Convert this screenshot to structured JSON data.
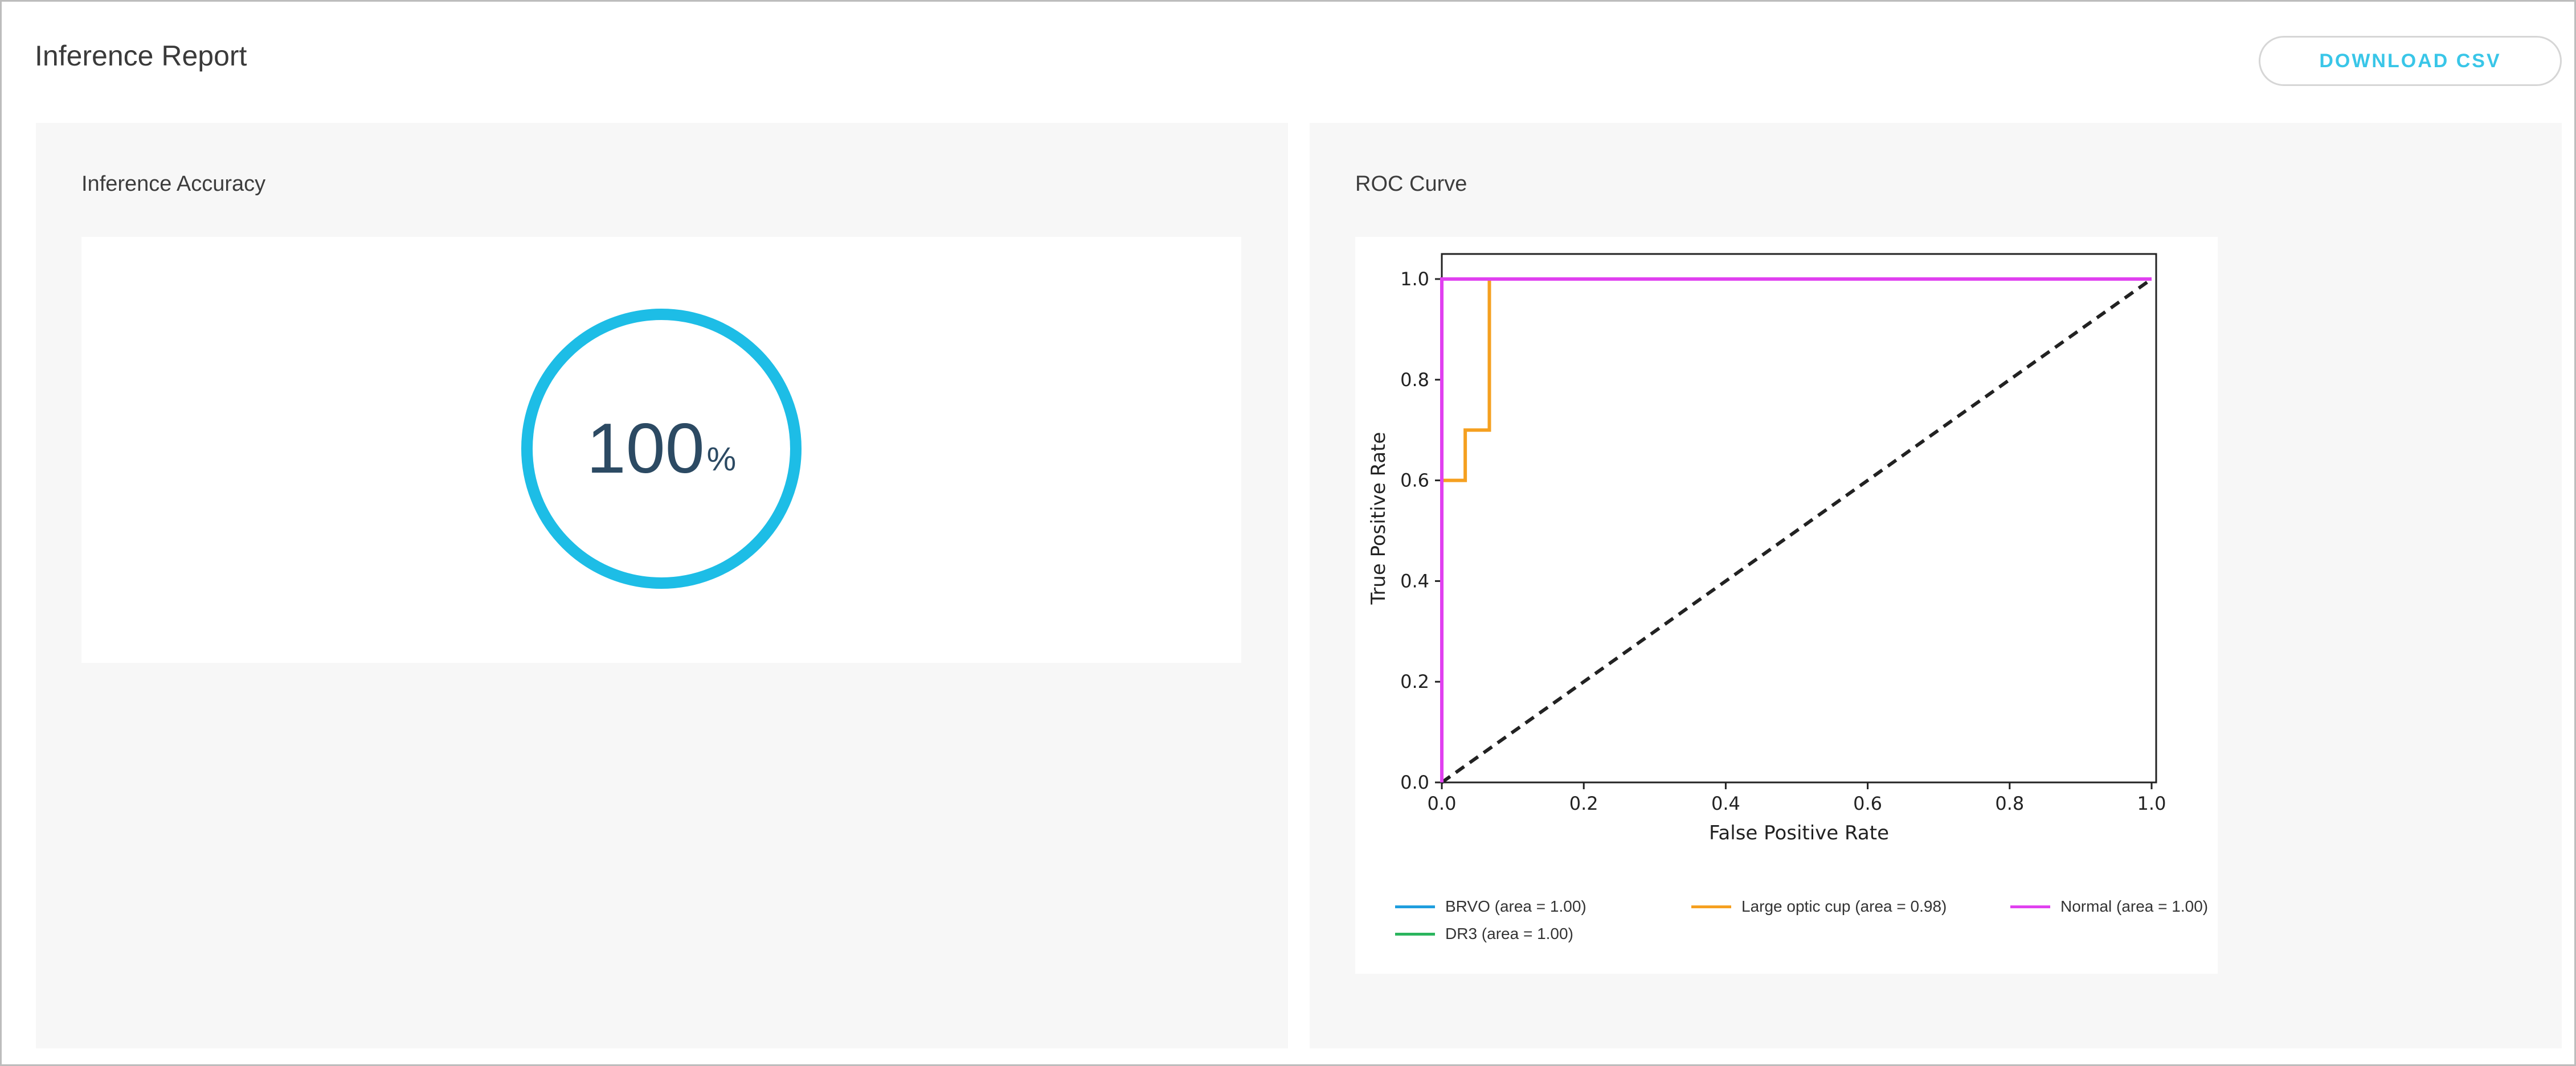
{
  "header": {
    "title": "Inference Report",
    "download_label": "DOWNLOAD CSV"
  },
  "accuracy_panel": {
    "title": "Inference Accuracy",
    "value": "100",
    "unit": "%",
    "fraction": 1.0,
    "ring_color": "#1dbde6",
    "text_color": "#2c4a63"
  },
  "roc_panel": {
    "title": "ROC Curve"
  },
  "chart_data": {
    "type": "line",
    "title": "",
    "xlabel": "False Positive Rate",
    "ylabel": "True Positive Rate",
    "xlim": [
      0.0,
      1.0
    ],
    "ylim": [
      0.0,
      1.0
    ],
    "xticks": [
      "0.0",
      "0.2",
      "0.4",
      "0.6",
      "0.8",
      "1.0"
    ],
    "yticks": [
      "0.0",
      "0.2",
      "0.4",
      "0.6",
      "0.8",
      "1.0"
    ],
    "grid": false,
    "legend_position": "bottom",
    "series": [
      {
        "name": "BRVO (area = 1.00)",
        "color": "#1f9ede",
        "x": [
          0.0,
          0.0,
          1.0
        ],
        "y": [
          0.0,
          1.0,
          1.0
        ]
      },
      {
        "name": "Large optic cup (area = 0.98)",
        "color": "#f5a020",
        "x": [
          0.0,
          0.0,
          0.033,
          0.033,
          0.067,
          0.067,
          1.0
        ],
        "y": [
          0.0,
          0.6,
          0.6,
          0.7,
          0.7,
          1.0,
          1.0
        ]
      },
      {
        "name": "Normal (area = 1.00)",
        "color": "#e040f0",
        "x": [
          0.0,
          0.0,
          1.0
        ],
        "y": [
          0.0,
          1.0,
          1.0
        ]
      },
      {
        "name": "DR3 (area = 1.00)",
        "color": "#2bb55e",
        "x": [
          0.0,
          0.0,
          1.0
        ],
        "y": [
          0.0,
          1.0,
          1.0
        ]
      }
    ],
    "baseline": {
      "x": [
        0.0,
        1.0
      ],
      "y": [
        0.0,
        1.0
      ],
      "style": "dashed",
      "color": "#222222"
    }
  }
}
